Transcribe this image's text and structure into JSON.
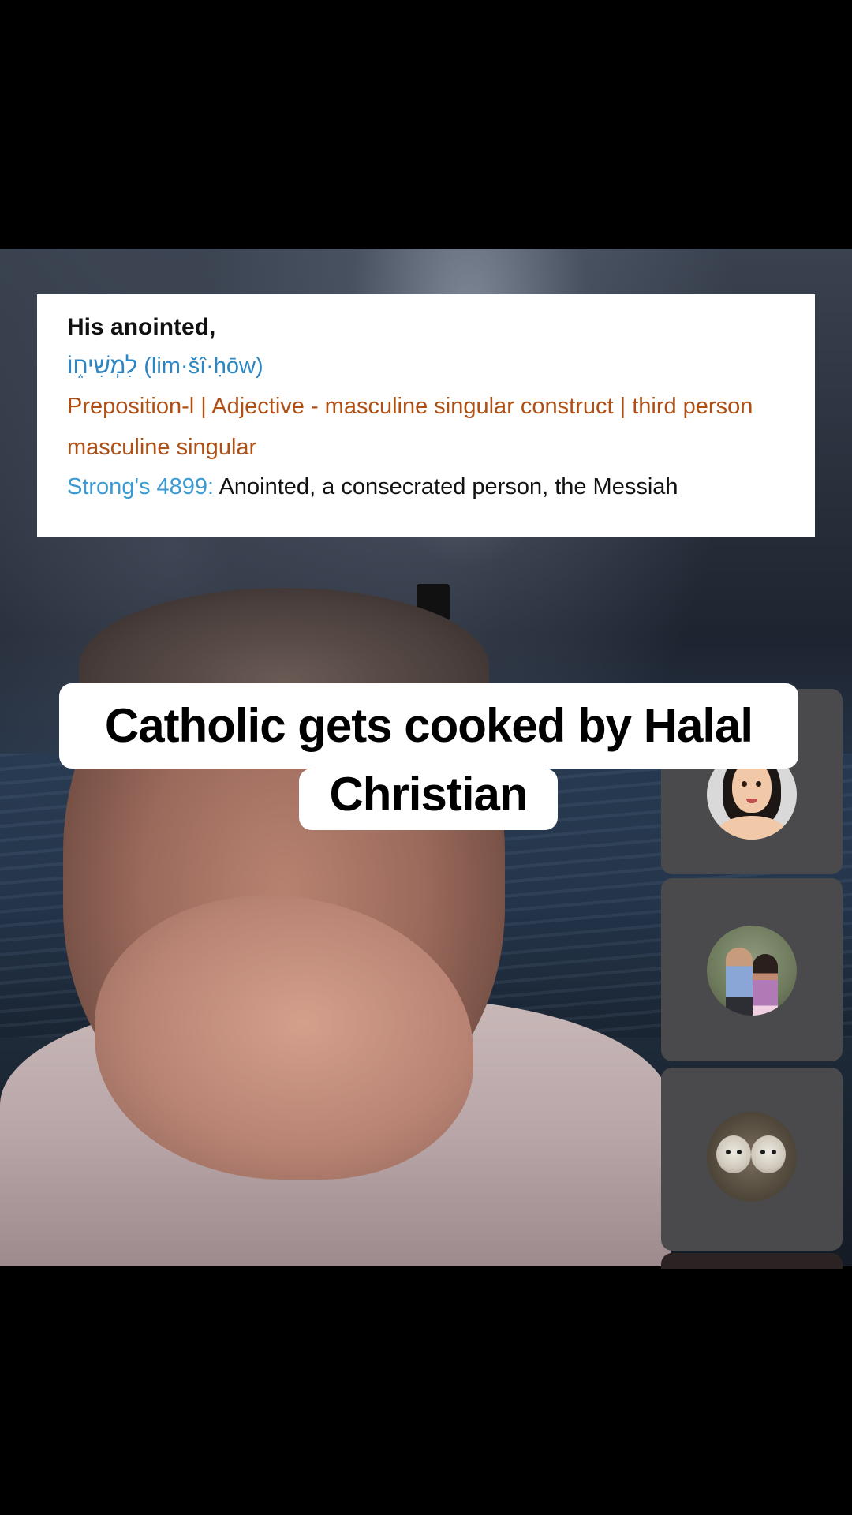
{
  "definition": {
    "heading": "His anointed,",
    "hebrew": "לִמְשִׁיח֑וֹ (lim·šî·ḥōw)",
    "grammar": "Preposition-l | Adjective - masculine singular construct | third person masculine singular",
    "strongs_label": "Strong's 4899:",
    "strongs_text": "Anointed, a consecrated person, the Messiah"
  },
  "caption": {
    "line1": "Catholic gets cooked by Halal",
    "line2": "Christian"
  },
  "participants": [
    {
      "avatar": "cartoon-woman-avatar"
    },
    {
      "avatar": "couple-photo-avatar"
    },
    {
      "avatar": "two-dogs-photo-avatar"
    }
  ],
  "colors": {
    "hebrew": "#2b86c4",
    "grammar": "#b04f14",
    "strongs_link": "#3a9ad1",
    "tile_bg": "#4a4a4d"
  }
}
